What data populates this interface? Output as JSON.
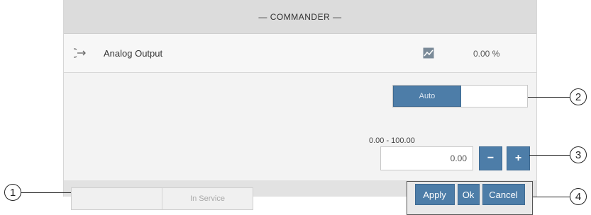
{
  "dialog": {
    "title": "— COMMANDER —"
  },
  "signal": {
    "icon": "output-arrow-icon",
    "label": "Analog Output",
    "trend_icon": "trend-chart-icon",
    "value": "0.00 %"
  },
  "mode": {
    "auto_label": "Auto",
    "other_label": ""
  },
  "setpoint": {
    "range": "0.00 - 100.00",
    "value": "0.00",
    "minus_label": "−",
    "plus_label": "+"
  },
  "service": {
    "left_label": "",
    "right_label": "In Service"
  },
  "actions": {
    "apply": "Apply",
    "ok": "Ok",
    "cancel": "Cancel"
  },
  "callouts": [
    "1",
    "2",
    "3",
    "4"
  ],
  "colors": {
    "accent": "#4d7da8",
    "title_bg": "#dcdcdc",
    "panel_bg": "#f3f3f3"
  }
}
